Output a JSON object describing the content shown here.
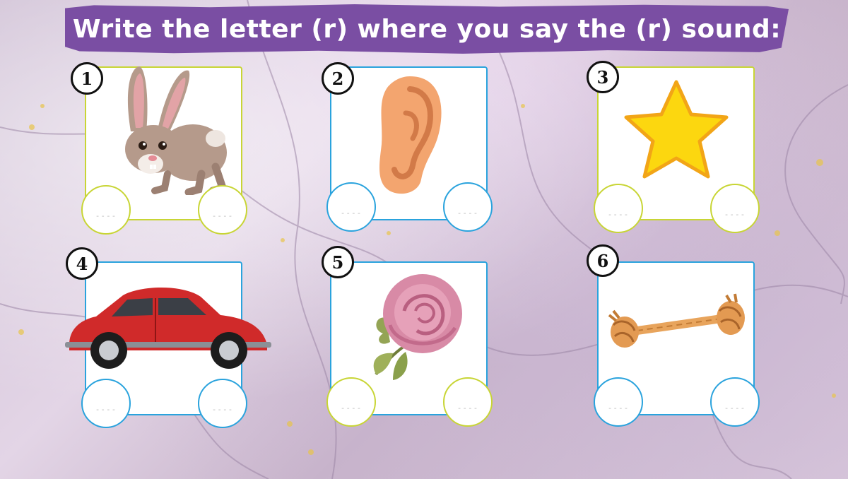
{
  "title": "Write the letter (r) where you say the (r) sound:",
  "colors": {
    "banner": "#7a4ea3",
    "green": "#c8d535",
    "blue": "#2aa3dd"
  },
  "placeholder": "----",
  "items": [
    {
      "number": "1",
      "icon": "rabbit-icon"
    },
    {
      "number": "2",
      "icon": "ear-icon"
    },
    {
      "number": "3",
      "icon": "star-icon"
    },
    {
      "number": "4",
      "icon": "car-icon"
    },
    {
      "number": "5",
      "icon": "rose-icon"
    },
    {
      "number": "6",
      "icon": "rope-icon"
    }
  ]
}
